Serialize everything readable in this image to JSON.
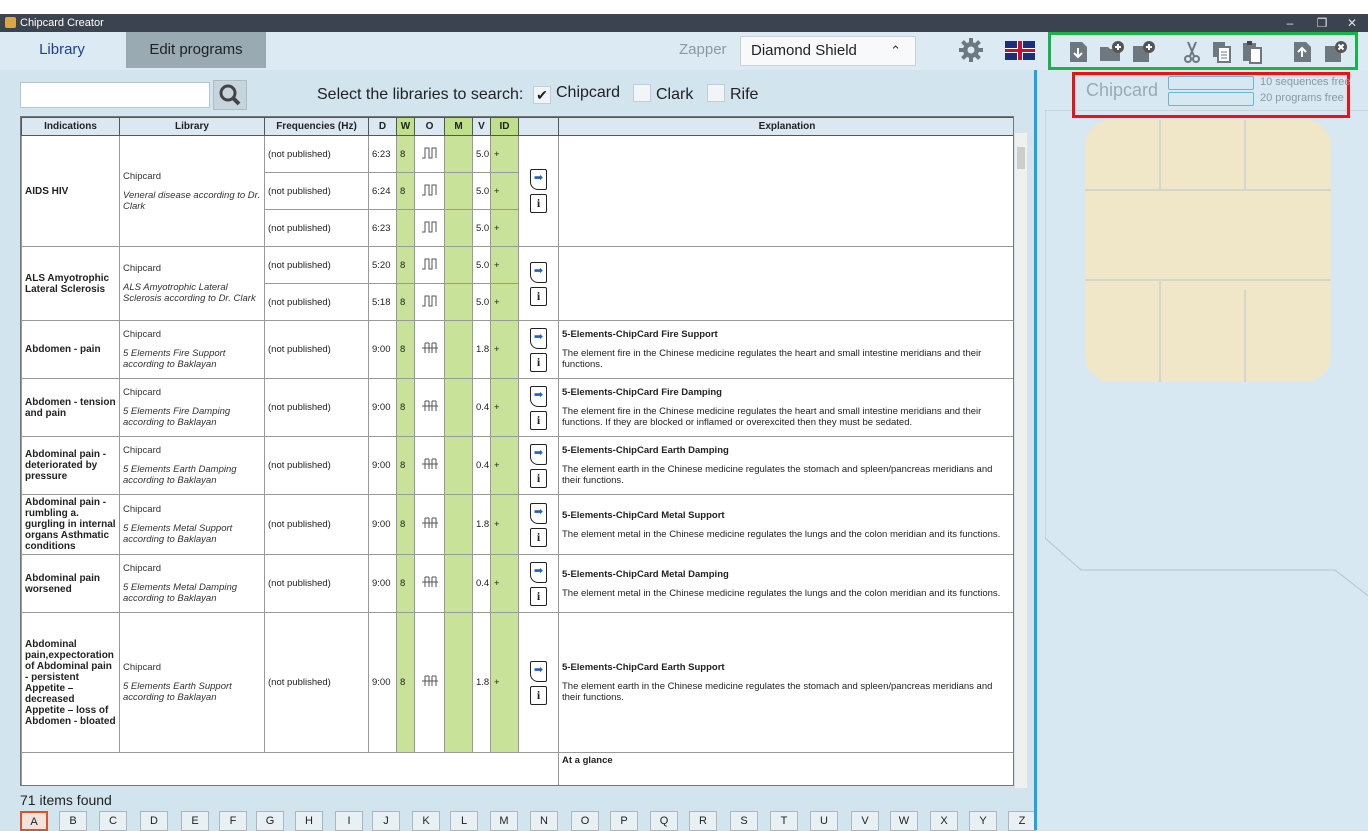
{
  "window": {
    "title": "Chipcard Creator",
    "min": "–",
    "restore": "❐",
    "close": "✕"
  },
  "tabs": {
    "library": "Library",
    "edit": "Edit programs"
  },
  "zapper": {
    "label": "Zapper",
    "value": "Diamond Shield",
    "chevron": "⌃⌄"
  },
  "search": {
    "placeholder": "",
    "icon": "magnifier-icon",
    "label": "Select the libraries to search:"
  },
  "libraries": [
    {
      "label": "Chipcard",
      "checked": true
    },
    {
      "label": "Clark",
      "checked": false
    },
    {
      "label": "Rife",
      "checked": false
    }
  ],
  "columns": [
    "Indications",
    "Library",
    "Frequencies (Hz)",
    "D",
    "W",
    "O",
    "M",
    "V",
    "ID",
    "",
    "Explanation"
  ],
  "rows": [
    {
      "ind": "AIDS HIV",
      "lib": "Chipcard",
      "libnote": "Veneral disease according to Dr. Clark",
      "subs": [
        {
          "f": "(not published)",
          "d": "6:23",
          "w": "8",
          "v": "5.0",
          "id": "+"
        },
        {
          "f": "(not published)",
          "d": "6:24",
          "w": "8",
          "v": "5.0",
          "id": "+"
        },
        {
          "f": "(not published)",
          "d": "6:23",
          "w": "",
          "v": "5.0",
          "id": "+"
        }
      ],
      "wave": "rect",
      "title": "",
      "text": ""
    },
    {
      "ind": "ALS Amyotrophic Lateral Sclerosis",
      "lib": "Chipcard",
      "libnote": "ALS Amyotrophic Lateral Sclerosis according to Dr. Clark",
      "subs": [
        {
          "f": "(not published)",
          "d": "5:20",
          "w": "8",
          "v": "5.0",
          "id": "+"
        },
        {
          "f": "(not published)",
          "d": "5:18",
          "w": "8",
          "v": "5.0",
          "id": "+"
        }
      ],
      "wave": "rect",
      "title": "",
      "text": ""
    },
    {
      "ind": "Abdomen - pain",
      "lib": "Chipcard",
      "libnote": "5 Elements Fire Support according to Baklayan",
      "subs": [
        {
          "f": "(not published)",
          "d": "9:00",
          "w": "8",
          "v": "1.8",
          "id": "+"
        }
      ],
      "wave": "multi",
      "title": "5-Elements-ChipCard Fire Support",
      "text": "The element fire in the Chinese medicine regulates the heart and small intestine meridians and their functions."
    },
    {
      "ind": "Abdomen - tension and pain",
      "lib": "Chipcard",
      "libnote": "5 Elements Fire Damping according to Baklayan",
      "subs": [
        {
          "f": "(not published)",
          "d": "9:00",
          "w": "8",
          "v": "0.4",
          "id": "+"
        }
      ],
      "wave": "multi",
      "title": "5-Elements-ChipCard Fire Damping",
      "text": "The element fire in the Chinese medicine regulates the heart and small intestine meridians and their functions. If they are blocked or inflamed or overexcited then they must be sedated."
    },
    {
      "ind": "Abdominal pain - deteriorated by pressure",
      "lib": "Chipcard",
      "libnote": "5 Elements Earth Damping according to Baklayan",
      "subs": [
        {
          "f": "(not published)",
          "d": "9:00",
          "w": "8",
          "v": "0.4",
          "id": "+"
        }
      ],
      "wave": "multi",
      "title": "5-Elements-ChipCard Earth Damping",
      "text": "The element earth in the Chinese medicine regulates the stomach and spleen/pancreas meridians and their functions."
    },
    {
      "ind": "Abdominal pain - rumbling a. gurgling in internal organs Asthmatic conditions",
      "lib": "Chipcard",
      "libnote": "5 Elements Metal Support according to Baklayan",
      "subs": [
        {
          "f": "(not published)",
          "d": "9:00",
          "w": "8",
          "v": "1.8",
          "id": "+"
        }
      ],
      "wave": "multi",
      "title": "5-Elements-ChipCard Metal Support",
      "text": "The element metal in the Chinese medicine regulates the lungs and the colon meridian and its functions."
    },
    {
      "ind": "Abdominal pain worsened",
      "lib": "Chipcard",
      "libnote": "5 Elements Metal Damping according to Baklayan",
      "subs": [
        {
          "f": "(not published)",
          "d": "9:00",
          "w": "8",
          "v": "0.4",
          "id": "+"
        }
      ],
      "wave": "multi",
      "title": "5-Elements-ChipCard Metal Damping",
      "text": "The element metal in the Chinese medicine regulates the lungs and the colon meridian and its functions."
    },
    {
      "ind": "Abdominal pain,expectoration of Abdominal pain - persistent Appetite – decreased Appetite – loss of Abdomen - bloated",
      "lib": "Chipcard",
      "libnote": "5 Elements Earth Support according to Baklayan",
      "subs": [
        {
          "f": "(not published)",
          "d": "9:00",
          "w": "8",
          "v": "1.8",
          "id": "+"
        }
      ],
      "wave": "multi",
      "title": "5-Elements-ChipCard Earth Support",
      "text": "The element earth in the Chinese medicine regulates the stomach and spleen/pancreas meridians and their functions."
    }
  ],
  "partial_row": {
    "title": "At a glance"
  },
  "found": "71 items found",
  "alphabet": [
    "A",
    "B",
    "C",
    "D",
    "E",
    "F",
    "G",
    "H",
    "I",
    "J",
    "K",
    "L",
    "M",
    "N",
    "O",
    "P",
    "Q",
    "R",
    "S",
    "T",
    "U",
    "V",
    "W",
    "X",
    "Y",
    "Z"
  ],
  "selected_letter": "A",
  "chipcard": {
    "label": "Chipcard",
    "seq_free": "10 sequences free",
    "prog_free": "20 programs free"
  },
  "toolbar_icons": [
    "card-read-icon",
    "folder-add-icon",
    "card-add-icon",
    "cut-icon",
    "copy-icon",
    "paste-icon",
    "card-write-icon",
    "card-delete-icon"
  ],
  "colors": {
    "highlight_green": "#18b44b",
    "highlight_red": "#ee1111",
    "highlight_blue": "#1fa3e8",
    "column_green": "#c8e29a"
  }
}
